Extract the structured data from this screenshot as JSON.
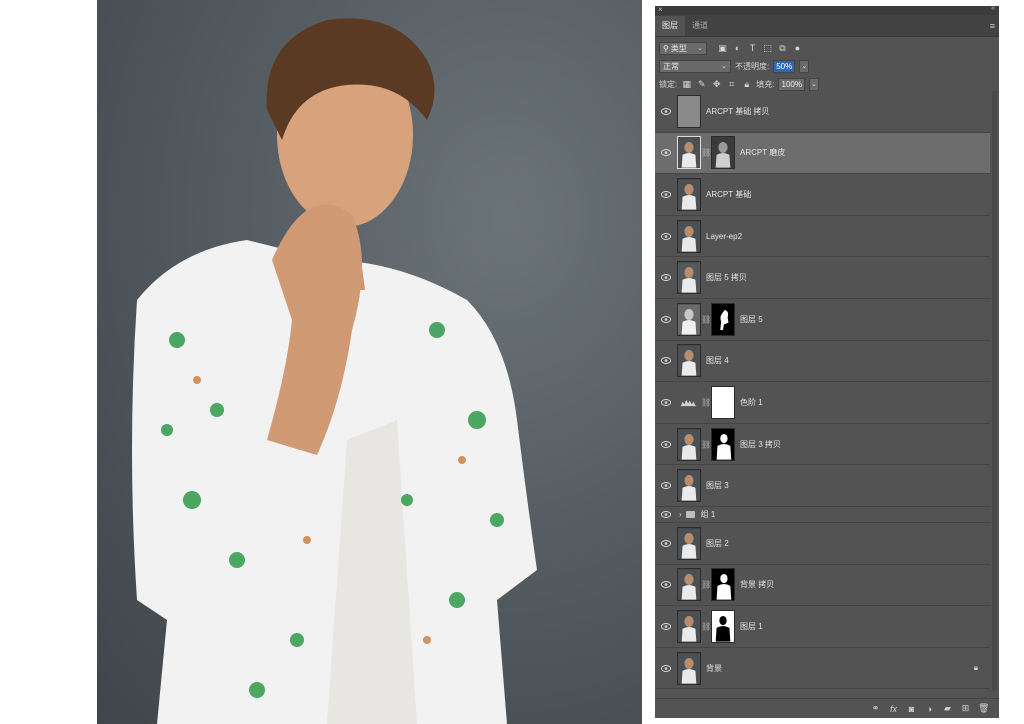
{
  "panel": {
    "tabs": [
      {
        "label": "图层"
      },
      {
        "label": "通道"
      }
    ],
    "filter": {
      "kind": "类型"
    },
    "blend_mode": "正常",
    "opacity": {
      "label": "不透明度:",
      "value": "50%"
    },
    "lock_label": "锁定:",
    "fill": {
      "label": "填充:",
      "value": "100%"
    }
  },
  "layers": [
    {
      "name": "ARCPT 基础 拷贝"
    },
    {
      "name": "ARCPT 磨皮"
    },
    {
      "name": "ARCPT 基础"
    },
    {
      "name": "Layer-ep2"
    },
    {
      "name": "图层 5 拷贝"
    },
    {
      "name": "图层 5"
    },
    {
      "name": "图层 4"
    },
    {
      "name": "色阶 1"
    },
    {
      "name": "图层 3 拷贝"
    },
    {
      "name": "图层 3"
    },
    {
      "name": "组 1"
    },
    {
      "name": "图层 2"
    },
    {
      "name": "背景 拷贝"
    },
    {
      "name": "图层 1"
    },
    {
      "name": "背景"
    }
  ],
  "icons": {
    "eye": "eye-icon",
    "link": "chain-link-icon",
    "lock": "lock-icon",
    "menu": "panel-menu-icon",
    "close": "close-icon",
    "collapse": "collapse-icon"
  },
  "colors": {
    "panel": "#535353",
    "selected": "#6d6d6d",
    "accent": "#2e67b3"
  }
}
